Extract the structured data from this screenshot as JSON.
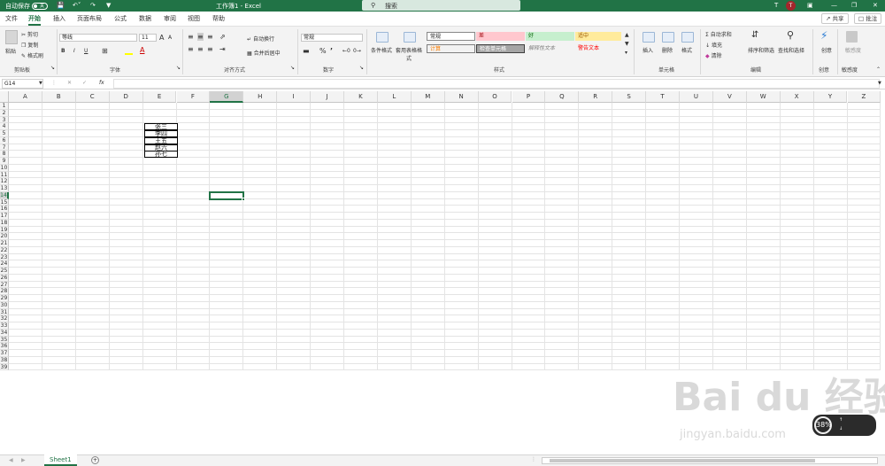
{
  "titlebar": {
    "autosave_label": "自动保存",
    "autosave_state": "关",
    "title": "工作簿1  -  Excel",
    "search_placeholder": "搜索",
    "user_initial": "T"
  },
  "menu": {
    "tabs": [
      "文件",
      "开始",
      "插入",
      "页面布局",
      "公式",
      "数据",
      "审阅",
      "视图",
      "帮助"
    ],
    "active": "开始",
    "share": "共享",
    "comments": "批注"
  },
  "ribbon": {
    "clipboard": {
      "label": "剪贴板",
      "paste": "粘贴",
      "cut": "剪切",
      "copy": "复制",
      "format_painter": "格式刷"
    },
    "font": {
      "label": "字体",
      "name": "等线",
      "size": "11",
      "bold": "B",
      "italic": "I",
      "underline": "U",
      "grow": "A",
      "shrink": "A"
    },
    "alignment": {
      "label": "对齐方式",
      "wrap": "自动换行",
      "merge": "合并后居中"
    },
    "number": {
      "label": "数字",
      "format": "常规",
      "percent": "%"
    },
    "styles": {
      "label": "样式",
      "conditional": "条件格式",
      "table": "套用表格格式",
      "cells": [
        "常规",
        "差",
        "好",
        "适中",
        "计算",
        "检查单元格",
        "解释性文本",
        "警告文本"
      ]
    },
    "cells_group": {
      "label": "单元格",
      "insert": "插入",
      "delete": "删除",
      "format": "格式"
    },
    "editing": {
      "label": "编辑",
      "autosum": "自动求和",
      "fill": "填充",
      "clear": "清除",
      "sort": "排序和筛选",
      "find": "查找和选择"
    },
    "ideas": {
      "label": "创意",
      "button": "创意"
    },
    "sensitivity": {
      "label": "敏感度",
      "button": "敏感度"
    }
  },
  "formula": {
    "namebox": "G14",
    "fx": "fx",
    "value": ""
  },
  "sheet": {
    "columns": [
      "A",
      "B",
      "C",
      "D",
      "E",
      "F",
      "G",
      "H",
      "I",
      "J",
      "K",
      "L",
      "M",
      "N",
      "O",
      "P",
      "Q",
      "R",
      "S",
      "T",
      "U",
      "V",
      "W",
      "X",
      "Y",
      "Z"
    ],
    "rows": [
      "1",
      "2",
      "3",
      "4",
      "5",
      "6",
      "7",
      "8",
      "9",
      "10",
      "11",
      "12",
      "13",
      "14",
      "15",
      "16",
      "17",
      "18",
      "19",
      "20",
      "21",
      "22",
      "23",
      "24",
      "25",
      "26",
      "27",
      "28",
      "29",
      "30",
      "31",
      "32",
      "33",
      "34",
      "35",
      "36",
      "37",
      "38",
      "39"
    ],
    "names": [
      "张三",
      "李四",
      "王五",
      "赵六",
      "孙七"
    ],
    "selected_cell": "G14"
  },
  "tabs": {
    "sheet_name": "Sheet1",
    "add": "+"
  },
  "overlay": {
    "watermark": "Bai du 经验",
    "watermark_sub": "jingyan.baidu.com",
    "widget_percent": "38%"
  }
}
